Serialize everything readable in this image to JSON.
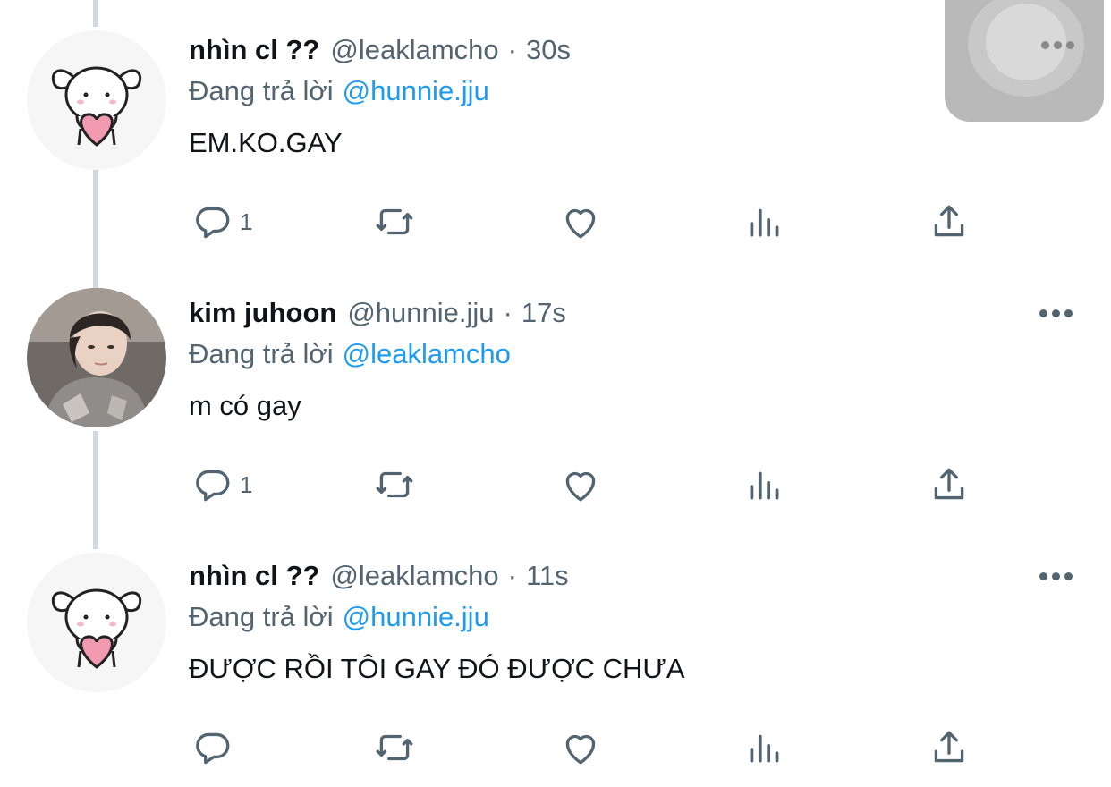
{
  "tweets": [
    {
      "name": "nhìn cl ??",
      "handle": "@leaklamcho",
      "time": "30s",
      "reply_prefix": "Đang trả lời",
      "reply_to": "@hunnie.jju",
      "text": "EM.KO.GAY",
      "reply_count": "1",
      "avatar_icon": "puppy-heart-avatar"
    },
    {
      "name": "kim juhoon",
      "handle": "@hunnie.jju",
      "time": "17s",
      "reply_prefix": "Đang trả lời",
      "reply_to": "@leaklamcho",
      "text": "m có gay",
      "reply_count": "1",
      "avatar_icon": "photo-avatar"
    },
    {
      "name": "nhìn cl ??",
      "handle": "@leaklamcho",
      "time": "11s",
      "reply_prefix": "Đang trả lời",
      "reply_to": "@hunnie.jju",
      "text": "ĐƯỢC RỒI TÔI GAY ĐÓ ĐƯỢC CHƯA",
      "reply_count": "",
      "avatar_icon": "puppy-heart-avatar"
    }
  ],
  "separator": "·",
  "colors": {
    "text": "#0f1419",
    "secondary": "#536471",
    "link": "#1d9bf0",
    "thread_line": "#cfd9de",
    "overlay": "#b9b9b9"
  },
  "icons": [
    "reply-icon",
    "retweet-icon",
    "like-icon",
    "views-icon",
    "share-icon",
    "more-icon"
  ]
}
